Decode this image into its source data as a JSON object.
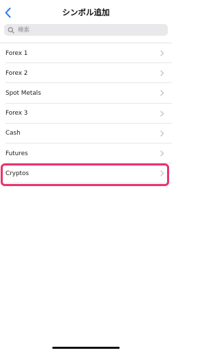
{
  "header": {
    "title": "シンボル追加"
  },
  "search": {
    "placeholder": "検索",
    "value": ""
  },
  "list": {
    "items": [
      {
        "label": "Forex 1"
      },
      {
        "label": "Forex 2"
      },
      {
        "label": "Spot Metals"
      },
      {
        "label": "Forex 3"
      },
      {
        "label": "Cash"
      },
      {
        "label": "Futures"
      },
      {
        "label": "Cryptos"
      }
    ]
  },
  "colors": {
    "accent": "#1a7cf4",
    "highlight": "#e8336b",
    "chevron": "#c4c4c7"
  },
  "icons": {
    "back": "chevron-left-icon",
    "search": "search-icon",
    "disclosure": "chevron-right-icon"
  }
}
